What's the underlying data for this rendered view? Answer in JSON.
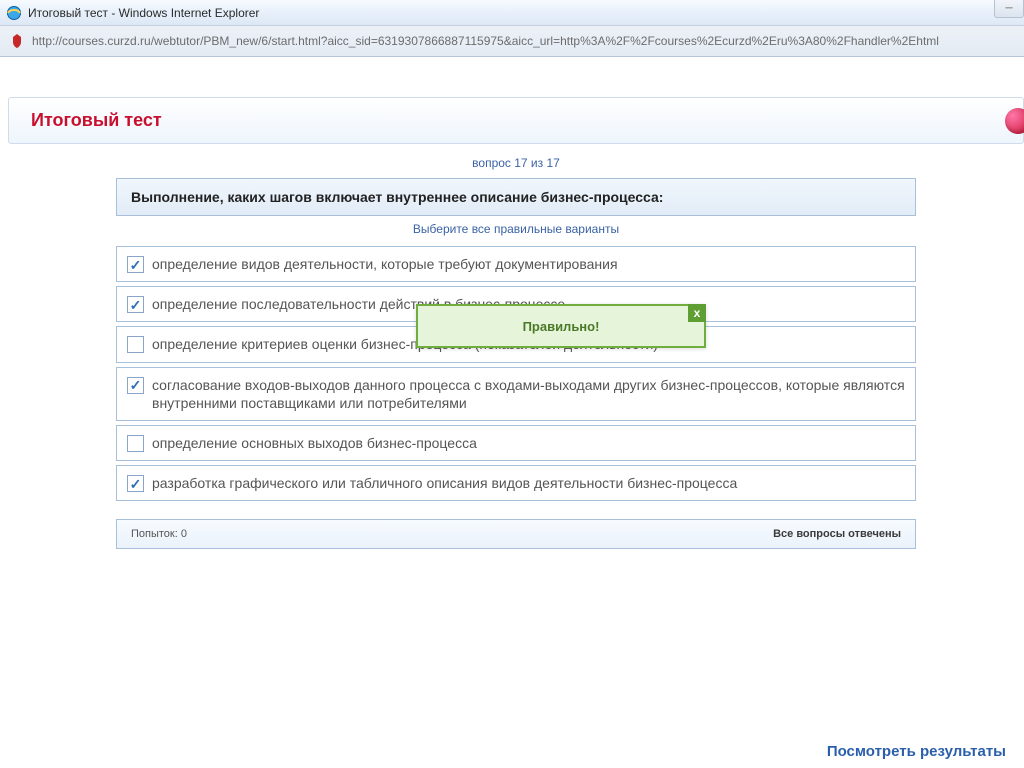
{
  "window": {
    "title": "Итоговый тест - Windows Internet Explorer",
    "url": "http://courses.curzd.ru/webtutor/PBM_new/6/start.html?aicc_sid=6319307866887115975&aicc_url=http%3A%2F%2Fcourses%2Ecurzd%2Eru%3A80%2Fhandler%2Ehtml"
  },
  "page": {
    "title": "Итоговый тест",
    "progress": "вопрос 17 из 17",
    "question": "Выполнение, каких шагов включает внутреннее описание бизнес-процесса:",
    "instruction": "Выберите все правильные варианты",
    "answers": [
      {
        "checked": true,
        "text": "определение видов деятельности, которые требуют документирования"
      },
      {
        "checked": true,
        "text": "определение последовательности действий в бизнес-процессе"
      },
      {
        "checked": false,
        "text": "определение критериев оценки бизнес-процесса (показателей деятельности)"
      },
      {
        "checked": true,
        "text": "согласование входов-выходов данного процесса с входами-выходами других бизнес-процессов, которые являются внутренними поставщиками или потребителями"
      },
      {
        "checked": false,
        "text": "определение основных выходов бизнес-процесса"
      },
      {
        "checked": true,
        "text": "разработка графического или табличного описания видов деятельности бизнес-процесса"
      }
    ],
    "footer": {
      "attempts_label": "Попыток: 0",
      "status": "Все вопросы отвечены"
    },
    "feedback": {
      "text": "Правильно!"
    },
    "results_link": "Посмотреть результаты"
  }
}
